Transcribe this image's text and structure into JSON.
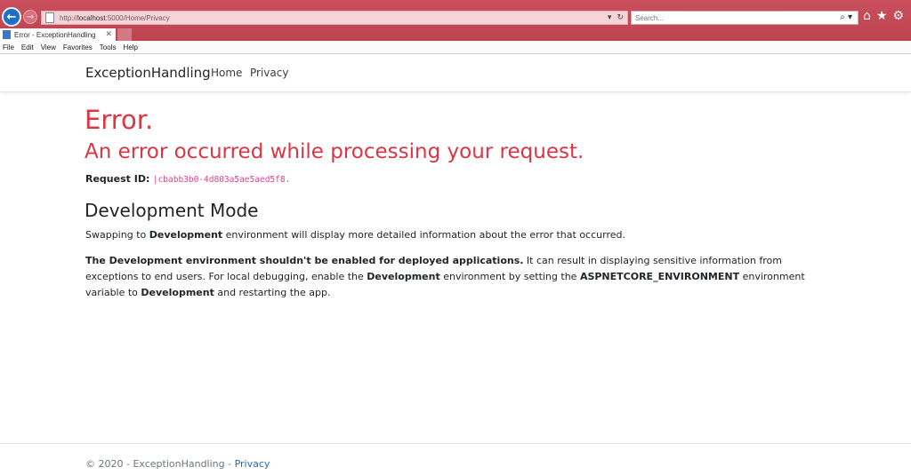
{
  "browser": {
    "url_prefix": "http://",
    "url_host": "localhost",
    "url_rest": ":5000/Home/Privacy",
    "search_placeholder": "Search...",
    "tab_title": "Error - ExceptionHandling",
    "menu": [
      "File",
      "Edit",
      "View",
      "Favorites",
      "Tools",
      "Help"
    ]
  },
  "site": {
    "brand": "ExceptionHandling",
    "nav": [
      "Home",
      "Privacy"
    ]
  },
  "content": {
    "title": "Error.",
    "subtitle": "An error occurred while processing your request.",
    "request_label": "Request ID:",
    "request_id": "|cbabb3b0-4d803a5ae5aed5f8.",
    "dev_heading": "Development Mode",
    "p1_pre": "Swapping to ",
    "p1_bold": "Development",
    "p1_post": " environment will display more detailed information about the error that occurred.",
    "p2_bold1": "The Development environment shouldn't be enabled for deployed applications.",
    "p2_text1": " It can result in displaying sensitive information from exceptions to end users. For local debugging, enable the ",
    "p2_bold2": "Development",
    "p2_text2": " environment by setting the ",
    "p2_bold3": "ASPNETCORE_ENVIRONMENT",
    "p2_text3": " environment variable to ",
    "p2_bold4": "Development",
    "p2_text4": " and restarting the app."
  },
  "footer": {
    "text": "© 2020 - ExceptionHandling - ",
    "link": "Privacy"
  },
  "colors": {
    "error": "#dc3545",
    "link": "#1b6ec2",
    "code": "#e83e8c",
    "chrome": "#c04854"
  }
}
